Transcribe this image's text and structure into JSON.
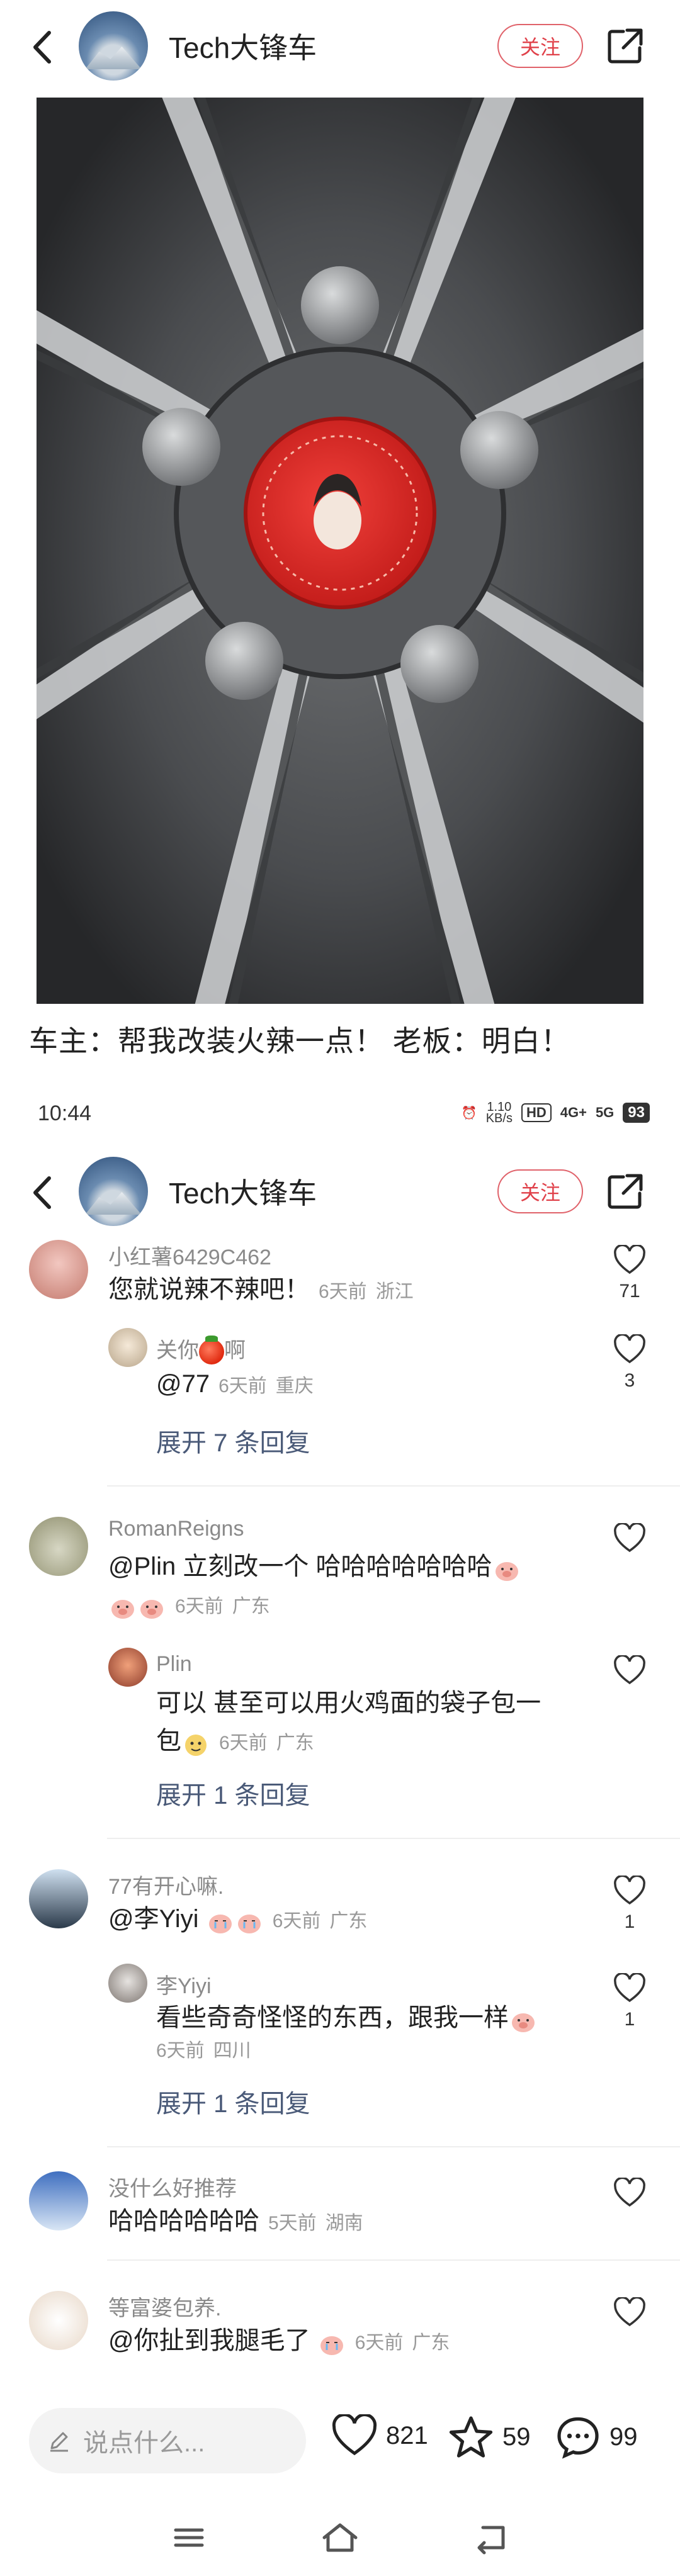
{
  "header": {
    "author": "Tech大锋车",
    "follow_label": "关注"
  },
  "post": {
    "caption": "车主：帮我改装火辣一点！ 老板：明白！"
  },
  "status_bar": {
    "time": "10:44",
    "net_speed": "1.10",
    "net_unit": "KB/s",
    "hd": "HD",
    "sig1": "4G+",
    "sig2": "5G",
    "battery": "93"
  },
  "comments": [
    {
      "user": "小红薯6429C462",
      "text": "您就说辣不辣吧！",
      "time": "6天前",
      "location": "浙江",
      "likes": "71"
    },
    {
      "user": "关你",
      "user_suffix": "啊",
      "text": "@77",
      "time": "6天前",
      "location": "重庆",
      "likes": "3"
    },
    {
      "expand": "展开 7 条回复"
    },
    {
      "user": "RomanReigns",
      "text": "@Plin  立刻改一个 哈哈哈哈哈哈哈",
      "time": "6天前",
      "location": "广东",
      "likes": ""
    },
    {
      "user": "Plin",
      "text_line1": "可以 甚至可以用火鸡面的袋子包一",
      "text_line2": "包",
      "time": "6天前",
      "location": "广东",
      "likes": ""
    },
    {
      "expand": "展开 1 条回复"
    },
    {
      "user": "77有开心嘛.",
      "text": "@李Yiyi",
      "time": "6天前",
      "location": "广东",
      "likes": "1"
    },
    {
      "user": "李Yiyi",
      "text": "看些奇奇怪怪的东西，跟我一样",
      "time": "6天前",
      "location": "四川",
      "likes": "1"
    },
    {
      "expand": "展开 1 条回复"
    },
    {
      "user": "没什么好推荐",
      "text": "哈哈哈哈哈哈",
      "time": "5天前",
      "location": "湖南",
      "likes": ""
    },
    {
      "user": "等富婆包养.",
      "text": "@你扯到我腿毛了",
      "time": "6天前",
      "location": "广东",
      "likes": ""
    }
  ],
  "bottom": {
    "placeholder": "说点什么...",
    "likes": "821",
    "stars": "59",
    "comments": "99"
  }
}
